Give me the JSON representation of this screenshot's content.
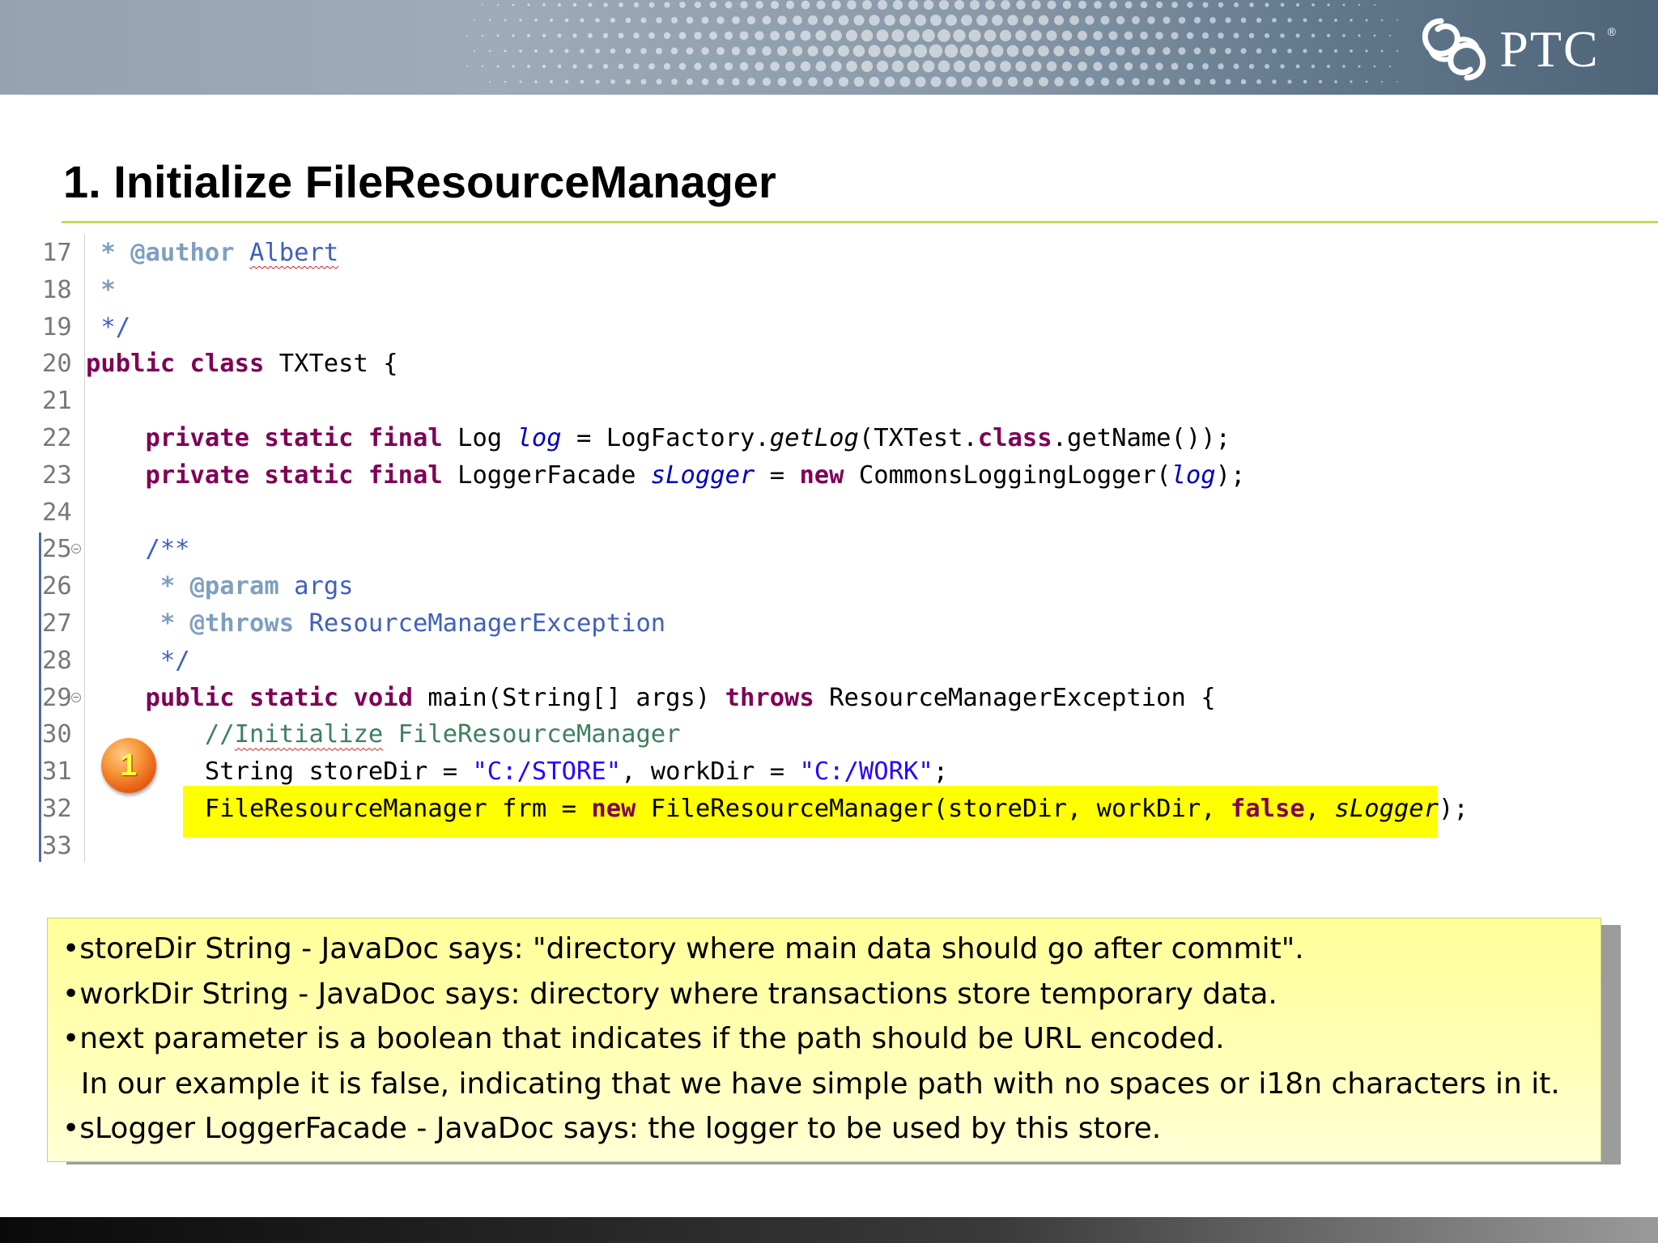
{
  "header": {
    "logo_text": "PTC",
    "logo_registered": "®",
    "logo_icon": "ptc-swirl-icon"
  },
  "slide": {
    "title": "1. Initialize FileResourceManager"
  },
  "code": {
    "lines": [
      {
        "num": "17",
        "parts": [
          {
            "cls": "jd",
            "text": " * @author "
          },
          {
            "cls": "cm squig",
            "text": "Albert"
          }
        ]
      },
      {
        "num": "18",
        "parts": [
          {
            "cls": "jd",
            "text": " *"
          }
        ]
      },
      {
        "num": "19",
        "parts": [
          {
            "cls": "cm",
            "text": " */"
          }
        ]
      },
      {
        "num": "20",
        "parts": [
          {
            "cls": "kw",
            "text": "public class "
          },
          {
            "cls": "",
            "text": "TXTest {"
          }
        ]
      },
      {
        "num": "21",
        "parts": []
      },
      {
        "num": "22",
        "parts": [
          {
            "cls": "",
            "text": "    "
          },
          {
            "cls": "kw",
            "text": "private static final "
          },
          {
            "cls": "",
            "text": "Log "
          },
          {
            "cls": "fld",
            "text": "log"
          },
          {
            "cls": "",
            "text": " = LogFactory."
          },
          {
            "cls": "it",
            "text": "getLog"
          },
          {
            "cls": "",
            "text": "(TXTest."
          },
          {
            "cls": "kw",
            "text": "class"
          },
          {
            "cls": "",
            "text": ".getName());"
          }
        ]
      },
      {
        "num": "23",
        "parts": [
          {
            "cls": "",
            "text": "    "
          },
          {
            "cls": "kw",
            "text": "private static final "
          },
          {
            "cls": "",
            "text": "LoggerFacade "
          },
          {
            "cls": "fld",
            "text": "sLogger"
          },
          {
            "cls": "",
            "text": " = "
          },
          {
            "cls": "kw",
            "text": "new "
          },
          {
            "cls": "",
            "text": "CommonsLoggingLogger("
          },
          {
            "cls": "fld",
            "text": "log"
          },
          {
            "cls": "",
            "text": ");"
          }
        ]
      },
      {
        "num": "24",
        "parts": []
      },
      {
        "num": "25",
        "fold": true,
        "parts": [
          {
            "cls": "",
            "text": "    "
          },
          {
            "cls": "cm",
            "text": "/**"
          }
        ]
      },
      {
        "num": "26",
        "parts": [
          {
            "cls": "",
            "text": "     "
          },
          {
            "cls": "jd",
            "text": "* @param "
          },
          {
            "cls": "cm",
            "text": "args"
          }
        ]
      },
      {
        "num": "27",
        "parts": [
          {
            "cls": "",
            "text": "     "
          },
          {
            "cls": "jd",
            "text": "* @throws "
          },
          {
            "cls": "cm",
            "text": "ResourceManagerException"
          }
        ]
      },
      {
        "num": "28",
        "parts": [
          {
            "cls": "",
            "text": "     "
          },
          {
            "cls": "cm",
            "text": "*/"
          }
        ]
      },
      {
        "num": "29",
        "fold": true,
        "parts": [
          {
            "cls": "",
            "text": "    "
          },
          {
            "cls": "kw",
            "text": "public static void "
          },
          {
            "cls": "",
            "text": "main(String[] args) "
          },
          {
            "cls": "kw",
            "text": "throws "
          },
          {
            "cls": "",
            "text": "ResourceManagerException {"
          }
        ]
      },
      {
        "num": "30",
        "parts": [
          {
            "cls": "",
            "text": "        "
          },
          {
            "cls": "lc",
            "text": "//"
          },
          {
            "cls": "lc squig",
            "text": "Initialize"
          },
          {
            "cls": "lc",
            "text": " FileResourceManager"
          }
        ]
      },
      {
        "num": "31",
        "parts": [
          {
            "cls": "",
            "text": "        String storeDir = "
          },
          {
            "cls": "str",
            "text": "\"C:/STORE\""
          },
          {
            "cls": "",
            "text": ", workDir = "
          },
          {
            "cls": "str",
            "text": "\"C:/WORK\""
          },
          {
            "cls": "",
            "text": ";"
          }
        ]
      },
      {
        "num": "32",
        "parts": [
          {
            "cls": "",
            "text": "        FileResourceManager frm = "
          },
          {
            "cls": "kw",
            "text": "new "
          },
          {
            "cls": "",
            "text": "FileResourceManager(storeDir, workDir, "
          },
          {
            "cls": "kw",
            "text": "false"
          },
          {
            "cls": "",
            "text": ", "
          },
          {
            "cls": "it",
            "text": "sLogger"
          },
          {
            "cls": "",
            "text": ");"
          }
        ]
      },
      {
        "num": "33",
        "parts": []
      }
    ]
  },
  "callout": {
    "badge_number": "1"
  },
  "notes": {
    "lines": [
      "•storeDir String - JavaDoc says: \"directory where main data should go after commit\".",
      "•workDir String - JavaDoc says: directory where transactions store temporary data.",
      "•next parameter is a boolean that indicates if the path should be URL encoded.",
      "  In our example it is false, indicating that we have simple path with no spaces or i18n characters in it.",
      "•sLogger LoggerFacade - JavaDoc says: the logger to be used by this store."
    ]
  }
}
